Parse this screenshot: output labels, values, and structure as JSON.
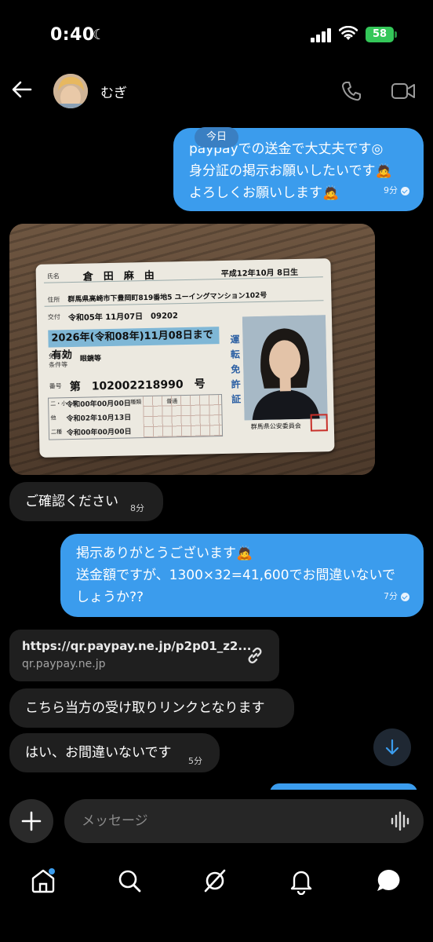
{
  "status_bar": {
    "time": "0:40",
    "battery": "58"
  },
  "header": {
    "contact_name": "むぎ"
  },
  "date_label": "今日",
  "messages": [
    {
      "lines": [
        "paypayでの送金で大丈夫です◎",
        "身分証の掲示お願いしたいです🙇",
        "よろしくお願いします🙇"
      ],
      "time": "9分"
    },
    {
      "text": "ご確認ください",
      "time": "8分"
    },
    {
      "lines": [
        "掲示ありがとうございます🙇",
        "送金額ですが、1300×32=41,600でお間違いないで",
        "しょうか??"
      ],
      "time": "7分"
    },
    {
      "text": "こちら当方の受け取りリンクとなります"
    },
    {
      "text": "はい、お間違いないです",
      "time": "5分"
    }
  ],
  "link_preview": {
    "url": "https://qr.paypay.ne.jp/p2p01_z2...",
    "domain": "qr.paypay.ne.jp"
  },
  "license_card": {
    "name_label": "氏名",
    "name": "倉　田　麻　由",
    "birth": "平成12年10月 8日生",
    "address_label": "住所",
    "address": "群馬県高崎市下豊岡町819番地5 ユーイングマンション102号",
    "issued_label": "交付",
    "issued": "令和05年 11月07日　09202",
    "expiry": "2026年(令和08年)11月08日まで有効",
    "conditions_label": "免許の条件等",
    "conditions": "眼鏡等",
    "number_label": "番号",
    "number": "第　102002218990　号",
    "vertical_title": "運転免許証",
    "issuer": "群馬県公安委員会",
    "seal": "群馬県公安委員会印",
    "history": [
      "令和00年00月00日",
      "令和02年10月13日",
      "令和00年00月00日"
    ],
    "history_labels": [
      "二・小・原",
      "他",
      "二種"
    ],
    "class_labels": [
      "種類",
      "普通"
    ]
  },
  "composer": {
    "placeholder": "メッセージ"
  },
  "colors": {
    "outgoing": "#3b9ced",
    "incoming": "#1f1f1f",
    "background": "#000000"
  }
}
